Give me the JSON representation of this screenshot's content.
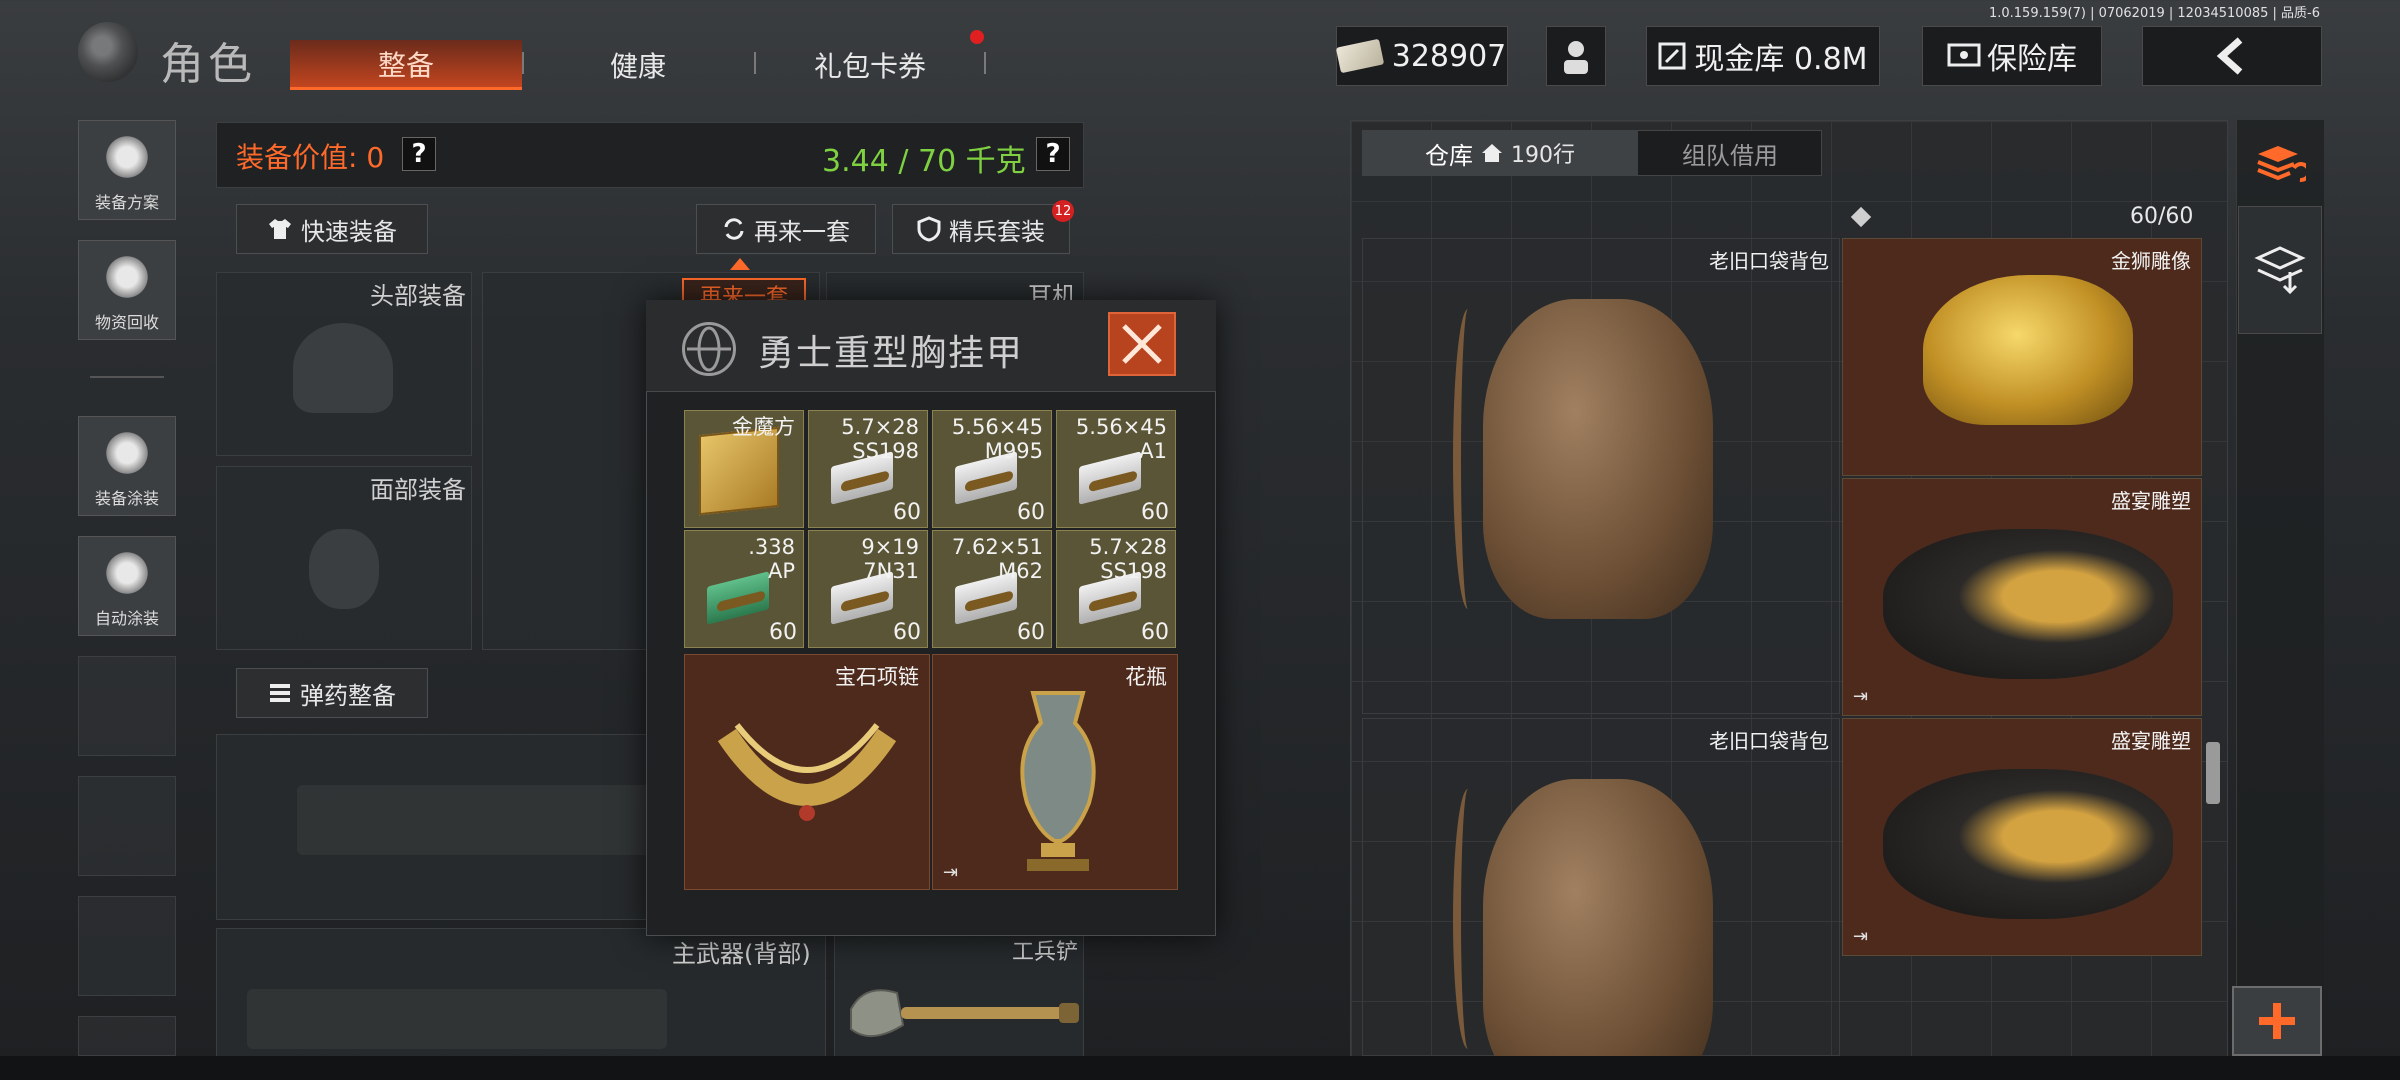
{
  "version": "1.0.159.159(7) | 07062019 | 12034510085 | 品质-6",
  "header": {
    "title": "角色",
    "tabs": [
      "整备",
      "健康",
      "礼包卡券"
    ],
    "active_tab": "整备",
    "cash": "328907",
    "vault_label": "现金库 0.8M",
    "safe_label": "保险库"
  },
  "sidebar": {
    "items": [
      {
        "label": "装备方案",
        "icon": "helmet-plan-icon"
      },
      {
        "label": "物资回收",
        "icon": "recycle-icon"
      },
      {
        "label": "装备涂装",
        "icon": "helmet-paint-icon"
      },
      {
        "label": "自动涂装",
        "icon": "auto-paint-icon"
      }
    ]
  },
  "equip": {
    "value_label": "装备价值:",
    "value": "0",
    "weight": "3.44 / 70 千克",
    "quick_equip": "快速装备",
    "again_set": "再来一套",
    "elite_set": "精兵套装",
    "elite_badge": "12",
    "again_tag": "再来一套",
    "slots": {
      "head": "头部装备",
      "face": "面部装备",
      "ear": "耳机",
      "primary": "主武器(背部)",
      "shovel": "工兵铲"
    },
    "ammo_equip": "弹药整备"
  },
  "popup": {
    "title": "勇士重型胸挂甲",
    "items": [
      {
        "name": "金魔方",
        "qty": ""
      },
      {
        "name": "5.7×28\nSS198",
        "qty": "60"
      },
      {
        "name": "5.56×45\nM995",
        "qty": "60"
      },
      {
        "name": "5.56×45\nA1",
        "qty": "60"
      },
      {
        "name": ".338\nAP",
        "qty": "60"
      },
      {
        "name": "9×19\n7N31",
        "qty": "60"
      },
      {
        "name": "7.62×51\nM62",
        "qty": "60"
      },
      {
        "name": "5.7×28\nSS198",
        "qty": "60"
      }
    ],
    "big_items": [
      {
        "name": "宝石项链"
      },
      {
        "name": "花瓶"
      }
    ]
  },
  "warehouse": {
    "tab_store": "仓库",
    "rows": "190行",
    "tab_team": "组队借用",
    "capacity": "60/60",
    "items": [
      {
        "name": "老旧口袋背包"
      },
      {
        "name": "金狮雕像"
      },
      {
        "name": "盛宴雕塑"
      },
      {
        "name": "老旧口袋背包"
      },
      {
        "name": "盛宴雕塑"
      }
    ]
  },
  "colors": {
    "accent": "#ff6a2a",
    "weight_green": "#7fd142",
    "gold_cell": "#5a5536",
    "rare_cell": "#4d2a1c"
  }
}
